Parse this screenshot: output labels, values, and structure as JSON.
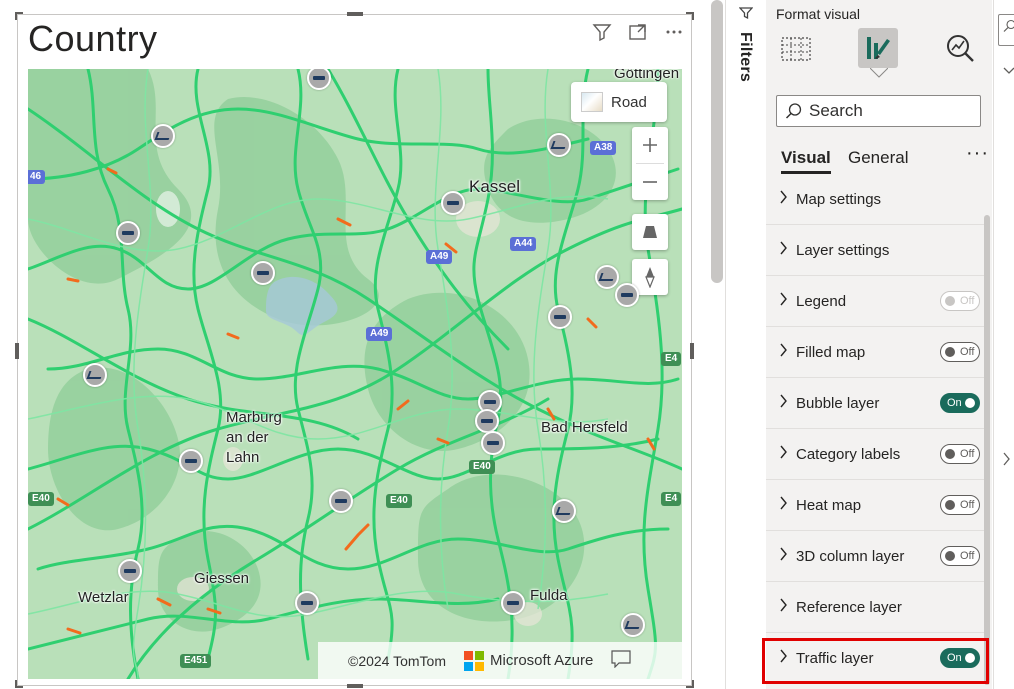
{
  "visual": {
    "title": "Country",
    "header_icons": [
      "filter-icon",
      "focus-mode-icon",
      "more-options-icon"
    ],
    "map": {
      "style_label": "Road",
      "cities": [
        "Göttingen",
        "Kassel",
        "Marburg an der Lahn",
        "Bad Hersfeld",
        "Giessen",
        "Wetzlar",
        "Fulda"
      ],
      "city_labels": {
        "gottingen": "Göttingen",
        "kassel": "Kassel",
        "marburg1": "Marburg",
        "marburg2": "an der",
        "marburg3": "Lahn",
        "bad_hersfeld": "Bad Hersfeld",
        "giessen": "Giessen",
        "wetzlar": "Wetzlar",
        "fulda": "Fulda"
      },
      "highways": {
        "a38": "A38",
        "a44": "A44",
        "a49_n": "A49",
        "a49_s": "A49",
        "e40_a": "E40",
        "e40_b": "E40",
        "e40_w": "E40",
        "e451": "E451",
        "left46": "46",
        "right40a": "E4",
        "right40b": "E4"
      },
      "copyright": "©2024 TomTom",
      "provider": "Microsoft Azure",
      "colors": {
        "land": "#b9e0b9",
        "forest": "#8ccc96",
        "road_flow": "#2fcf70",
        "congestion": "#f26b1d",
        "incident": "#a9a9a9"
      }
    }
  },
  "filters_pane": {
    "label": "Filters"
  },
  "format_pane": {
    "title": "Format visual",
    "search_placeholder": "Search",
    "tabs": [
      "Visual",
      "General"
    ],
    "tab_visual": "Visual",
    "tab_general": "General",
    "more": "···",
    "sections": [
      {
        "label": "Map settings",
        "toggle": null
      },
      {
        "label": "Layer settings",
        "toggle": null
      },
      {
        "label": "Legend",
        "toggle": "Off",
        "disabled": true
      },
      {
        "label": "Filled map",
        "toggle": "Off"
      },
      {
        "label": "Bubble layer",
        "toggle": "On"
      },
      {
        "label": "Category labels",
        "toggle": "Off"
      },
      {
        "label": "Heat map",
        "toggle": "Off"
      },
      {
        "label": "3D column layer",
        "toggle": "Off"
      },
      {
        "label": "Reference layer",
        "toggle": null
      },
      {
        "label": "Traffic layer",
        "toggle": "On",
        "highlighted": true
      }
    ]
  }
}
